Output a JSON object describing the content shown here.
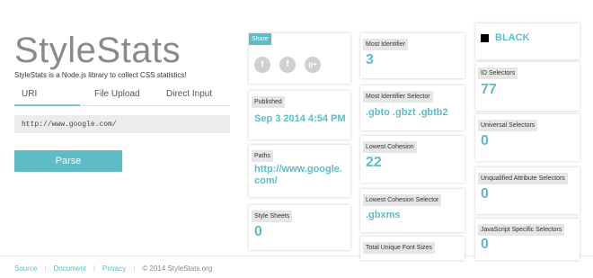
{
  "brand": {
    "name": "StyleStats",
    "tagline": "StyleStats is a Node.js library to collect CSS statistics!"
  },
  "tabs": [
    "URI",
    "File Upload",
    "Direct Input"
  ],
  "url_input": {
    "value": "http://www.google.com/"
  },
  "parse_label": "Parse",
  "footer": {
    "links": [
      "Source",
      "Document",
      "Privacy"
    ],
    "copyright": "© 2014 StyleStats.org"
  },
  "share": {
    "label": "Share",
    "icons": [
      "twitter-icon",
      "facebook-icon",
      "google-plus-icon"
    ]
  },
  "stats": {
    "published": {
      "label": "Published",
      "value": "Sep 3 2014 4:54 PM"
    },
    "paths": {
      "label": "Paths",
      "value": "http://www.google.com/"
    },
    "style_sheets": {
      "label": "Style Sheets",
      "value": "0"
    },
    "most_identifier": {
      "label": "Most Identifier",
      "value": "3"
    },
    "most_identifier_selector": {
      "label": "Most Identifier Selector",
      "value": ".gbto .gbzt .gbtb2"
    },
    "lowest_cohesion": {
      "label": "Lowest Cohesion",
      "value": "22"
    },
    "lowest_cohesion_selector": {
      "label": "Lowest Cohesion Selector",
      "value": ".gbxms"
    },
    "total_unique_font_sizes": {
      "label": "Total Unique Font Sizes"
    },
    "color": {
      "value": "BLACK",
      "swatch": "#000000"
    },
    "id_selectors": {
      "label": "ID Selectors",
      "value": "77"
    },
    "universal_selectors": {
      "label": "Universal Selectors",
      "value": "0"
    },
    "unqualified_attribute_selectors": {
      "label": "Unqualified Attribute Selectors",
      "value": "0"
    },
    "javascript_specific_selectors": {
      "label": "JavaScript Specific Selectors",
      "value": "0"
    }
  },
  "colors": {
    "accent": "#5ebcc7",
    "brand_gray": "#8a8a8a"
  }
}
